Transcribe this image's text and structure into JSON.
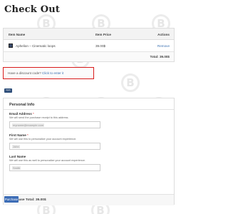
{
  "page": {
    "title": "Check Out"
  },
  "cart": {
    "headers": {
      "name": "Item Name",
      "price": "Item Price",
      "actions": "Actions"
    },
    "items": [
      {
        "name": "Aphelion – Cinematic loops",
        "price": "39.00$",
        "action": "Remove"
      }
    ],
    "total": "Total: 39.00$"
  },
  "discount": {
    "question": "Have a discount code?",
    "link": "Click to enter it"
  },
  "apply_button": "Apply",
  "personal_info": {
    "title": "Personal Info",
    "email": {
      "label": "Email Address",
      "required": "*",
      "help": "We will send the purchase receipt to this address.",
      "value": "myname@example.com"
    },
    "first_name": {
      "label": "First Name",
      "required": "*",
      "help": "We will use this to personalize your account experience.",
      "value": "John"
    },
    "last_name": {
      "label": "Last Name",
      "help": "We will use this as well to personalize your account experience.",
      "value": "Smith"
    },
    "purchase_total": "Purchase Total: 39.00$"
  },
  "purchase_button": "Purchase",
  "colors": {
    "accent": "#3d6db6",
    "highlight_border": "#d81b1b"
  }
}
